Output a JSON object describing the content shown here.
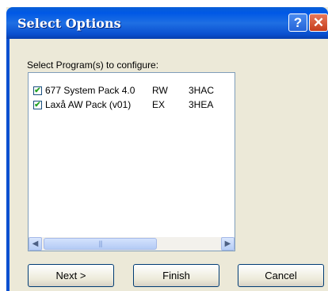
{
  "window": {
    "title": "Select Options",
    "help_label": "?",
    "close_label": "✕"
  },
  "prompt": "Select Program(s) to configure:",
  "programs": [
    {
      "checked": true,
      "name": "677 System Pack 4.0",
      "mode": "RW",
      "code": "3HAC"
    },
    {
      "checked": true,
      "name": "Laxå AW Pack (v01)",
      "mode": "EX",
      "code": "3HEA"
    }
  ],
  "scrollbar": {
    "left_arrow": "◀",
    "right_arrow": "▶",
    "grip": "|||"
  },
  "buttons": {
    "next": "Next >",
    "finish": "Finish",
    "cancel": "Cancel"
  },
  "colors": {
    "titlebar": "#0058e6",
    "dialog_bg": "#ece9d8",
    "close_button": "#c53d1c"
  }
}
